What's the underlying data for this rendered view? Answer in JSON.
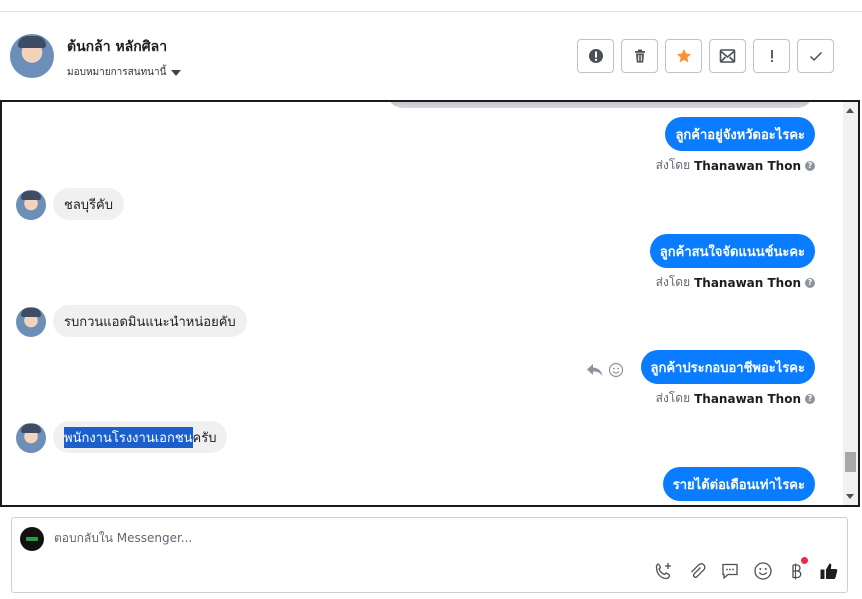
{
  "header": {
    "contact_name": "ต้นกล้า หลักศิลา",
    "assign_label": "มอบหมายการสนทนานี้",
    "actions": [
      {
        "icon": "alert-circle-icon",
        "label": "!"
      },
      {
        "icon": "trash-icon",
        "label": ""
      },
      {
        "icon": "star-icon",
        "label": ""
      },
      {
        "icon": "mark-unread-icon",
        "label": ""
      },
      {
        "icon": "exclamation-icon",
        "label": "!"
      },
      {
        "icon": "check-icon",
        "label": ""
      }
    ],
    "star_color": "#f7923b"
  },
  "conversation": {
    "messages": [
      {
        "direction": "out",
        "text": "ลูกค้าอยู่จังหวัดอะไรคะ",
        "sent_by_prefix": "ส่งโดย",
        "sender": "Thanawan Thon"
      },
      {
        "direction": "in",
        "text": "ชลบุรีคับ"
      },
      {
        "direction": "out",
        "text": "ลูกค้าสนใจจัดแนนช์นะคะ",
        "sent_by_prefix": "ส่งโดย",
        "sender": "Thanawan Thon"
      },
      {
        "direction": "in",
        "text": "รบกวนแอดมินแนะนำหน่อยคับ"
      },
      {
        "direction": "out",
        "text": "ลูกค้าประกอบอาชีพอะไรคะ",
        "sent_by_prefix": "ส่งโดย",
        "sender": "Thanawan Thon"
      },
      {
        "direction": "in",
        "text_highlighted": "พนักงานโรงงานเอกชน",
        "text_rest": "ครับ"
      },
      {
        "direction": "out",
        "text": "รายได้ต่อเดือนเท่าไรคะ"
      }
    ],
    "bubble_color": "#0a7cff"
  },
  "composer": {
    "placeholder": "ตอบกลับใน Messenger...",
    "tools": [
      "call-add-icon",
      "attachment-icon",
      "saved-reply-icon",
      "emoji-icon",
      "baht-payment-icon",
      "like-icon"
    ]
  }
}
